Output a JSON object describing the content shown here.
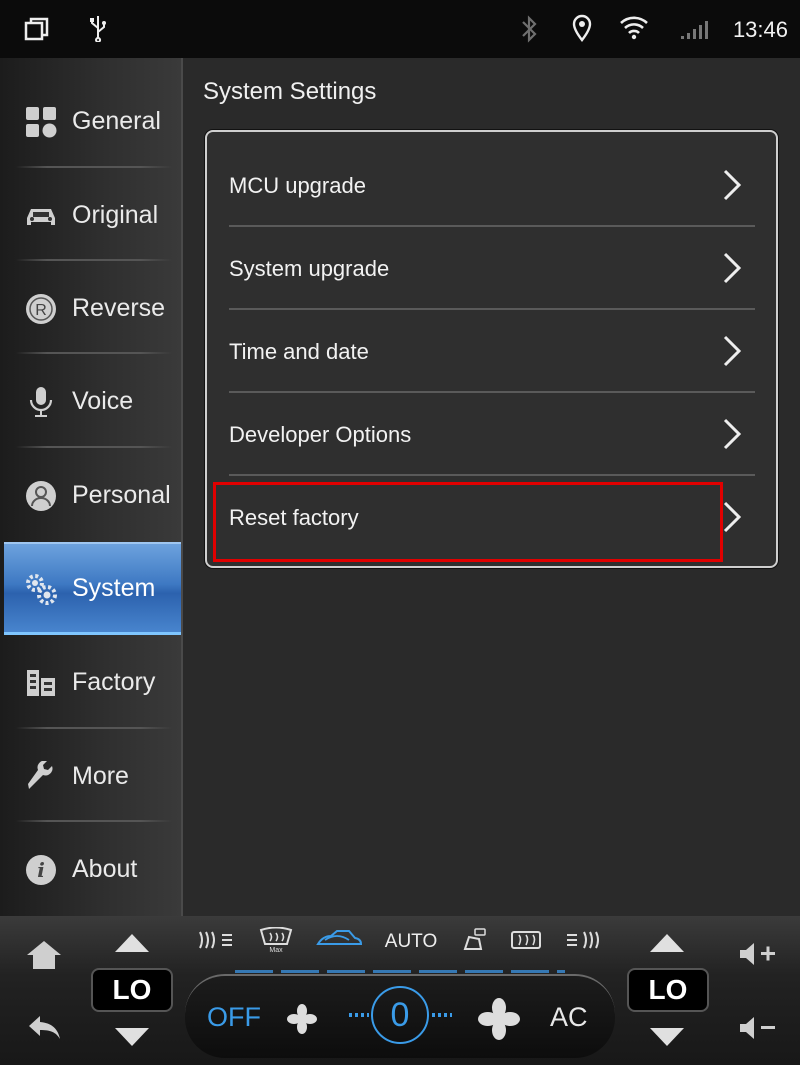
{
  "statusbar": {
    "time": "13:46",
    "icons": [
      "recent-apps-icon",
      "usb-icon",
      "bluetooth-icon",
      "location-icon",
      "wifi-icon",
      "signal-icon"
    ]
  },
  "sidebar": {
    "items": [
      {
        "label": "General",
        "icon": "grid-icon"
      },
      {
        "label": "Original",
        "icon": "car-icon"
      },
      {
        "label": "Reverse",
        "icon": "reverse-icon"
      },
      {
        "label": "Voice",
        "icon": "microphone-icon"
      },
      {
        "label": "Personal",
        "icon": "person-icon"
      },
      {
        "label": "System",
        "icon": "gears-icon",
        "active": true
      },
      {
        "label": "Factory",
        "icon": "factory-icon"
      },
      {
        "label": "More",
        "icon": "wrench-icon"
      },
      {
        "label": "About",
        "icon": "info-icon"
      }
    ]
  },
  "content": {
    "title": "System Settings",
    "rows": [
      {
        "label": "MCU upgrade"
      },
      {
        "label": "System upgrade"
      },
      {
        "label": "Time and date"
      },
      {
        "label": "Developer Options"
      },
      {
        "label": "Reset factory",
        "highlighted": true
      }
    ]
  },
  "climate": {
    "left_temp": "LO",
    "right_temp": "LO",
    "mode": "AUTO",
    "fan_level": "0",
    "power": "OFF",
    "ac": "AC"
  },
  "colors": {
    "accent": "#3a9be8",
    "highlight": "#e10000",
    "active_tab": "#3e79c3"
  }
}
